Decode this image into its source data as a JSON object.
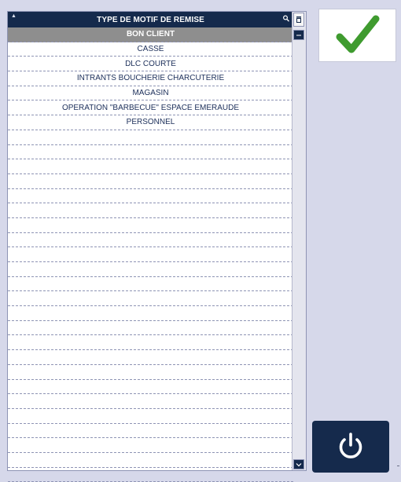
{
  "list": {
    "header": "TYPE DE MOTIF DE REMISE",
    "items": [
      "BON CLIENT",
      "CASSE",
      "DLC COURTE",
      "INTRANTS BOUCHERIE CHARCUTERIE",
      "MAGASIN",
      "OPERATION \"BARBECUE\" ESPACE EMERAUDE",
      "PERSONNEL",
      "",
      "",
      "",
      "",
      "",
      "",
      "",
      "",
      "",
      "",
      "",
      "",
      "",
      "",
      "",
      "",
      "",
      "",
      "",
      "",
      "",
      "",
      "",
      ""
    ],
    "selected_index": 0
  },
  "buttons": {
    "confirm_icon": "checkmark-icon",
    "power_icon": "power-icon"
  },
  "colors": {
    "background": "#d6d8ea",
    "header": "#152a4c",
    "selected_row": "#8e8e8e",
    "confirm_check": "#3f9b2f"
  }
}
